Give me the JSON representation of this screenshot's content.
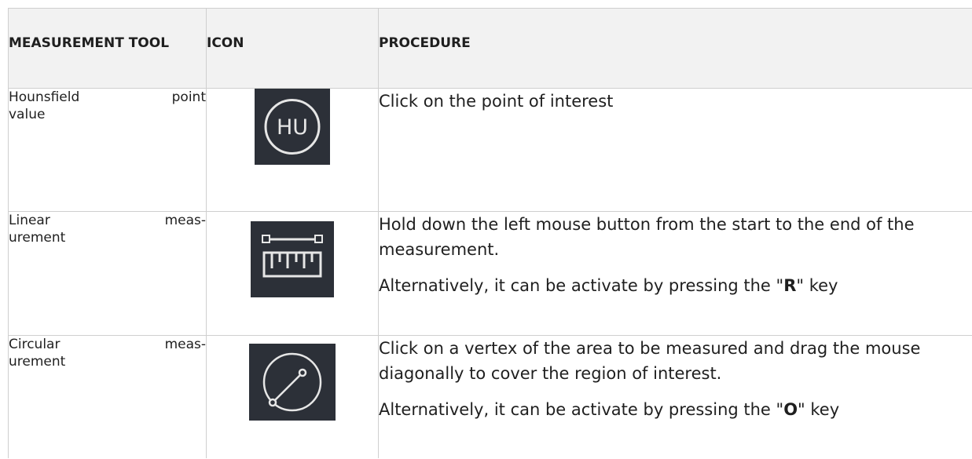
{
  "header": {
    "tool": "MEASUREMENT TOOL",
    "icon": "ICON",
    "procedure": "PROCEDURE"
  },
  "rows": [
    {
      "tool_line1": "Hounsfield point",
      "tool_line2": "value",
      "icon": "hu-icon",
      "icon_text": "HU",
      "procedure": "Click on the point of interest"
    },
    {
      "tool_line1": "Linear meas-",
      "tool_line2": "urement",
      "icon": "ruler-icon",
      "procedure": "Hold down the left mouse button from the start to the end of the measurement.",
      "alt_prefix": "Alternatively, it can be activate by pressing the \"",
      "alt_key": "R",
      "alt_suffix": "\" key"
    },
    {
      "tool_line1": "Circular meas-",
      "tool_line2": "urement",
      "icon": "circle-measure-icon",
      "procedure": "Click on a vertex of the area to be measured and drag the mouse diagonally to cover the region of interest.",
      "alt_prefix": "Alternatively, it can be activate by pressing the \"",
      "alt_key": "O",
      "alt_suffix": "\" key"
    }
  ],
  "colors": {
    "header_bg": "#f2f2f2",
    "icon_bg": "#2c3038",
    "icon_stroke": "#e6e6e6",
    "border": "#cfcfcf"
  }
}
